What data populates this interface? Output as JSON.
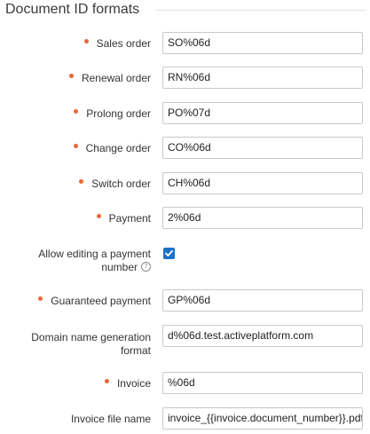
{
  "section": {
    "title": "Document ID formats"
  },
  "fields": {
    "sales_order": {
      "label": "Sales order",
      "value": "SO%06d",
      "required": true
    },
    "renewal_order": {
      "label": "Renewal order",
      "value": "RN%06d",
      "required": true
    },
    "prolong_order": {
      "label": "Prolong order",
      "value": "PO%07d",
      "required": true
    },
    "change_order": {
      "label": "Change order",
      "value": "CO%06d",
      "required": true
    },
    "switch_order": {
      "label": "Switch order",
      "value": "CH%06d",
      "required": true
    },
    "payment": {
      "label": "Payment",
      "value": "2%06d",
      "required": true
    },
    "allow_editing_payment_number": {
      "label_line1": "Allow editing a payment",
      "label_line2": "number",
      "checked": true,
      "help_icon": "question-circle-icon"
    },
    "guaranteed_payment": {
      "label": "Guaranteed payment",
      "value": "GP%06d",
      "required": true
    },
    "domain_name_generation_format": {
      "label_line1": "Domain name generation",
      "label_line2": "format",
      "value": "d%06d.test.activeplatform.com",
      "required": false
    },
    "invoice": {
      "label": "Invoice",
      "value": "%06d",
      "required": true
    },
    "invoice_file_name": {
      "label": "Invoice file name",
      "value": "invoice_{{invoice.document_number}}.pdf",
      "required": false
    }
  },
  "colors": {
    "required_dot": "#e8663a",
    "checkbox": "#1a73c9",
    "input_border": "#c9c9c9"
  }
}
